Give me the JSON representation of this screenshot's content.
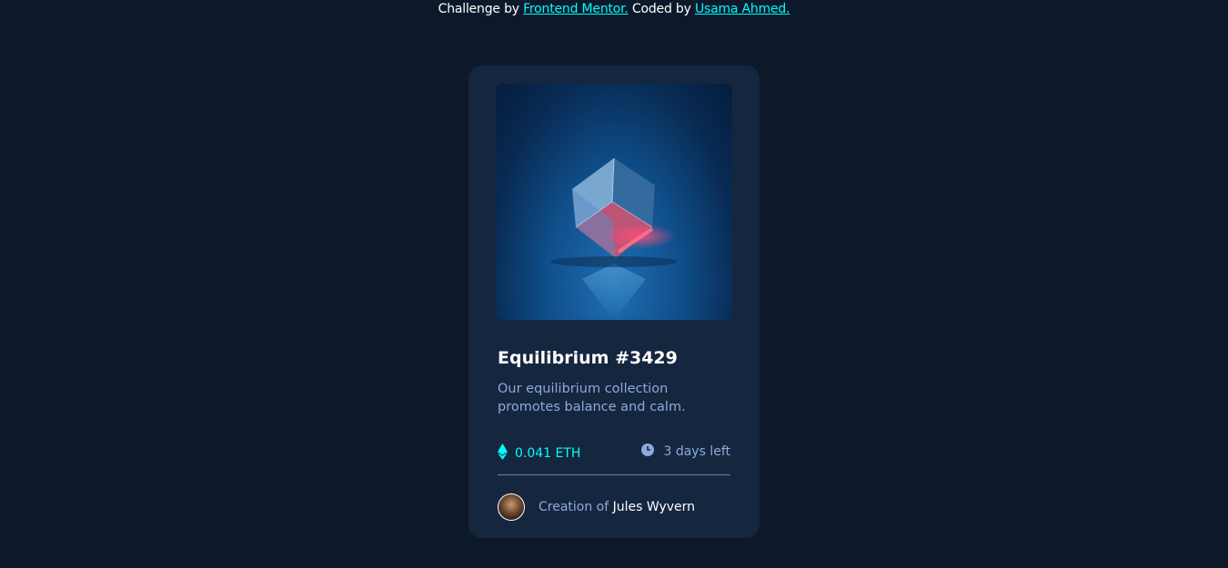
{
  "attribution": {
    "prefix": "Challenge by ",
    "link1": "Frontend Mentor.",
    "middle": " Coded by ",
    "link2": "Usama Ahmed."
  },
  "card": {
    "title": "Equilibrium #3429",
    "description": "Our equilibrium collection promotes balance and calm.",
    "price": "0.041 ETH",
    "time_left": "3 days left",
    "creator_prefix": "Creation of ",
    "creator_name": "Jules Wyvern"
  },
  "icons": {
    "eth": "ethereum-icon",
    "clock": "clock-icon"
  },
  "colors": {
    "page_bg": "#0d192b",
    "card_bg": "#15263f",
    "cyan": "#00fff8",
    "soft_blue": "#8bacd9",
    "white": "#ffffff"
  }
}
